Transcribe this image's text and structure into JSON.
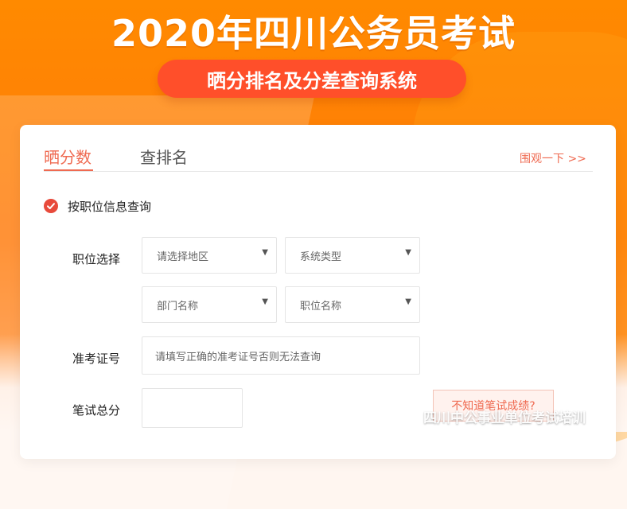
{
  "header": {
    "title": "2020年四川公务员考试",
    "subtitle": "晒分排名及分差查询系统"
  },
  "tabs": [
    {
      "label": "晒分数",
      "active": true
    },
    {
      "label": "查排名",
      "active": false
    }
  ],
  "look_link": "围观一下 >>",
  "form": {
    "query_option_label": "按职位信息查询",
    "position_select_label": "职位选择",
    "selects": {
      "region": "请选择地区",
      "system_type": "系统类型",
      "department": "部门名称",
      "position_name": "职位名称"
    },
    "admission_label": "准考证号",
    "admission_placeholder": "请填写正确的准考证号否则无法查询",
    "written_score_label": "笔试总分",
    "dont_know_score": "不知道笔试成绩?"
  },
  "watermark": {
    "text": "四川中公事业单位考试培训",
    "icon": "weibo-icon"
  },
  "colors": {
    "accent": "#ef6a51",
    "badge": "#ff4f2a",
    "radio": "#e84a3b",
    "background": "#ff8a00"
  }
}
